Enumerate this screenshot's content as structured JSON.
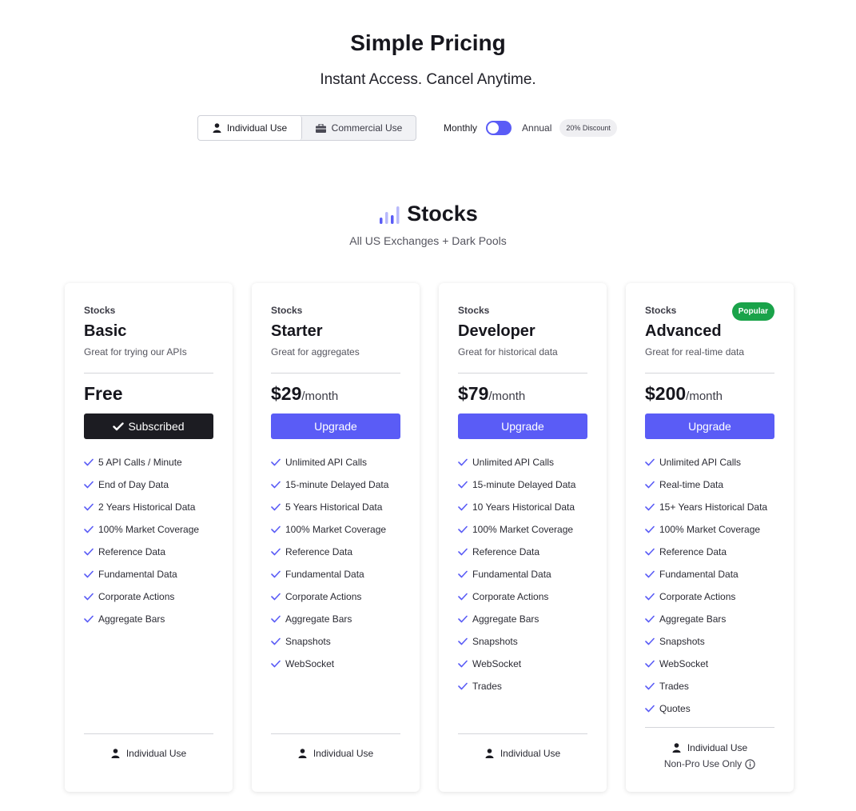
{
  "header": {
    "title": "Simple Pricing",
    "subtitle": "Instant Access. Cancel Anytime."
  },
  "use_toggle": {
    "individual_label": "Individual Use",
    "commercial_label": "Commercial Use",
    "selected": "Individual Use"
  },
  "billing": {
    "monthly_label": "Monthly",
    "annual_label": "Annual",
    "discount_label": "20% Discount",
    "selected": "Monthly"
  },
  "section": {
    "title": "Stocks",
    "subtitle": "All US Exchanges + Dark Pools",
    "icon": "bar-chart-icon"
  },
  "colors": {
    "accent": "#5a5cf6",
    "subscribed_button": "#1c1c22",
    "popular_badge": "#1aa34a"
  },
  "plans": [
    {
      "category": "Stocks",
      "name": "Basic",
      "description": "Great for trying our APIs",
      "price": "Free",
      "period": "",
      "button": "Subscribed",
      "button_state": "subscribed",
      "features": [
        "5 API Calls / Minute",
        "End of Day Data",
        "2 Years Historical Data",
        "100% Market Coverage",
        "Reference Data",
        "Fundamental Data",
        "Corporate Actions",
        "Aggregate Bars"
      ],
      "footer": "Individual Use"
    },
    {
      "category": "Stocks",
      "name": "Starter",
      "description": "Great for aggregates",
      "price": "$29",
      "period": "/month",
      "button": "Upgrade",
      "button_state": "upgrade",
      "features": [
        "Unlimited API Calls",
        "15-minute Delayed Data",
        "5 Years Historical Data",
        "100% Market Coverage",
        "Reference Data",
        "Fundamental Data",
        "Corporate Actions",
        "Aggregate Bars",
        "Snapshots",
        "WebSocket"
      ],
      "footer": "Individual Use"
    },
    {
      "category": "Stocks",
      "name": "Developer",
      "description": "Great for historical data",
      "price": "$79",
      "period": "/month",
      "button": "Upgrade",
      "button_state": "upgrade",
      "features": [
        "Unlimited API Calls",
        "15-minute Delayed Data",
        "10 Years Historical Data",
        "100% Market Coverage",
        "Reference Data",
        "Fundamental Data",
        "Corporate Actions",
        "Aggregate Bars",
        "Snapshots",
        "WebSocket",
        "Trades"
      ],
      "footer": "Individual Use"
    },
    {
      "category": "Stocks",
      "name": "Advanced",
      "description": "Great for real-time data",
      "price": "$200",
      "period": "/month",
      "button": "Upgrade",
      "button_state": "upgrade",
      "badge": "Popular",
      "features": [
        "Unlimited API Calls",
        "Real-time Data",
        "15+ Years Historical Data",
        "100% Market Coverage",
        "Reference Data",
        "Fundamental Data",
        "Corporate Actions",
        "Aggregate Bars",
        "Snapshots",
        "WebSocket",
        "Trades",
        "Quotes"
      ],
      "footer": "Individual Use",
      "footer_note": "Non-Pro Use Only"
    }
  ]
}
